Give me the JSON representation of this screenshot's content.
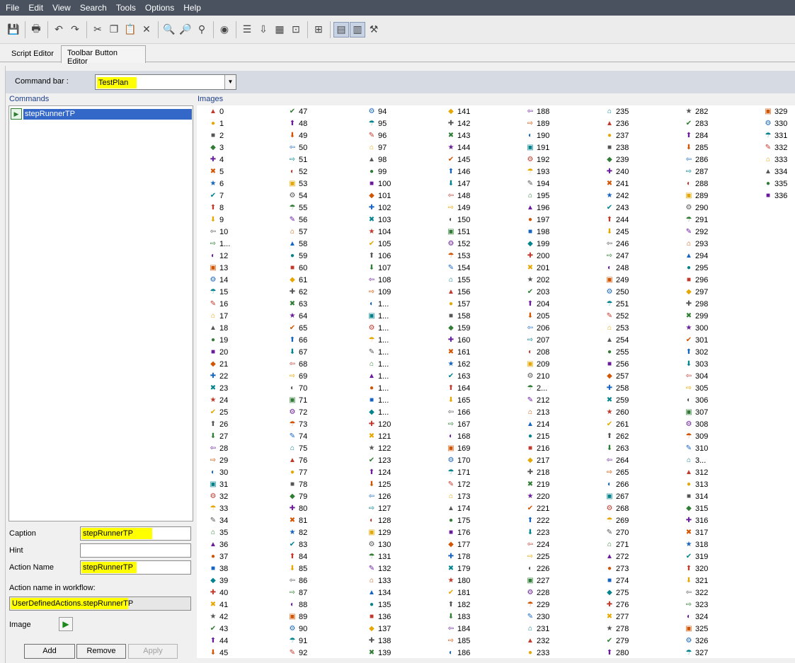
{
  "menu": [
    "File",
    "Edit",
    "View",
    "Search",
    "Tools",
    "Options",
    "Help"
  ],
  "toolbar_icons": [
    "save-icon",
    "print-icon",
    "undo-icon",
    "redo-icon",
    "cut-icon",
    "copy-icon",
    "paste-icon",
    "delete-icon",
    "find-icon",
    "find-next-icon",
    "replace-icon",
    "globe-icon",
    "list-icon",
    "step-icon",
    "grid-icon",
    "export-icon",
    "filter-icon",
    "view-left-icon",
    "view-right-icon",
    "tools-icon"
  ],
  "tabs": [
    "Script Editor",
    "Toolbar Button Editor"
  ],
  "command_bar": {
    "label": "Command bar :",
    "value": "TestPlan"
  },
  "commands": {
    "header": "Commands",
    "items": [
      "stepRunnerTP"
    ]
  },
  "images": {
    "header": "Images",
    "columns": [
      [
        "0",
        "1",
        "2",
        "3",
        "4",
        "5",
        "6",
        "7",
        "8",
        "9",
        "10",
        "1...",
        "12",
        "13",
        "14",
        "15",
        "16",
        "17",
        "18",
        "19",
        "20",
        "21",
        "22",
        "23",
        "24",
        "25",
        "26",
        "27",
        "28",
        "29",
        "30",
        "31",
        "32",
        "33",
        "34",
        "35",
        "36",
        "37",
        "38",
        "39",
        "40",
        "41",
        "42",
        "43",
        "44",
        "45"
      ],
      [
        "47",
        "48",
        "49",
        "50",
        "51",
        "52",
        "53",
        "54",
        "55",
        "56",
        "57",
        "58",
        "59",
        "60",
        "61",
        "62",
        "63",
        "64",
        "65",
        "66",
        "67",
        "68",
        "69",
        "70",
        "71",
        "72",
        "73",
        "74",
        "75",
        "76",
        "77",
        "78",
        "79",
        "80",
        "81",
        "82",
        "83",
        "84",
        "85",
        "86",
        "87",
        "88",
        "89",
        "90",
        "91",
        "92"
      ],
      [
        "94",
        "95",
        "96",
        "97",
        "98",
        "99",
        "100",
        "101",
        "102",
        "103",
        "104",
        "105",
        "106",
        "107",
        "108",
        "109",
        "1...",
        "1...",
        "1...",
        "1...",
        "1...",
        "1...",
        "1...",
        "1...",
        "1...",
        "1...",
        "120",
        "121",
        "122",
        "123",
        "124",
        "125",
        "126",
        "127",
        "128",
        "129",
        "130",
        "131",
        "132",
        "133",
        "134",
        "135",
        "136",
        "137",
        "138",
        "139"
      ],
      [
        "141",
        "142",
        "143",
        "144",
        "145",
        "146",
        "147",
        "148",
        "149",
        "150",
        "151",
        "152",
        "153",
        "154",
        "155",
        "156",
        "157",
        "158",
        "159",
        "160",
        "161",
        "162",
        "163",
        "164",
        "165",
        "166",
        "167",
        "168",
        "169",
        "170",
        "171",
        "172",
        "173",
        "174",
        "175",
        "176",
        "177",
        "178",
        "179",
        "180",
        "181",
        "182",
        "183",
        "184",
        "185",
        "186"
      ],
      [
        "188",
        "189",
        "190",
        "191",
        "192",
        "193",
        "194",
        "195",
        "196",
        "197",
        "198",
        "199",
        "200",
        "201",
        "202",
        "203",
        "204",
        "205",
        "206",
        "207",
        "208",
        "209",
        "210",
        "2...",
        "212",
        "213",
        "214",
        "215",
        "216",
        "217",
        "218",
        "219",
        "220",
        "221",
        "222",
        "223",
        "224",
        "225",
        "226",
        "227",
        "228",
        "229",
        "230",
        "231",
        "232",
        "233"
      ],
      [
        "235",
        "236",
        "237",
        "238",
        "239",
        "240",
        "241",
        "242",
        "243",
        "244",
        "245",
        "246",
        "247",
        "248",
        "249",
        "250",
        "251",
        "252",
        "253",
        "254",
        "255",
        "256",
        "257",
        "258",
        "259",
        "260",
        "261",
        "262",
        "263",
        "264",
        "265",
        "266",
        "267",
        "268",
        "269",
        "270",
        "271",
        "272",
        "273",
        "274",
        "275",
        "276",
        "277",
        "278",
        "279",
        "280"
      ],
      [
        "282",
        "283",
        "284",
        "285",
        "286",
        "287",
        "288",
        "289",
        "290",
        "291",
        "292",
        "293",
        "294",
        "295",
        "296",
        "297",
        "298",
        "299",
        "300",
        "301",
        "302",
        "303",
        "304",
        "305",
        "306",
        "307",
        "308",
        "309",
        "310",
        "3...",
        "312",
        "313",
        "314",
        "315",
        "316",
        "317",
        "318",
        "319",
        "320",
        "321",
        "322",
        "323",
        "324",
        "325",
        "326",
        "327"
      ],
      [
        "329",
        "330",
        "331",
        "332",
        "333",
        "334",
        "335",
        "336"
      ]
    ]
  },
  "form": {
    "caption_label": "Caption",
    "caption_value": "stepRunnerTP",
    "hint_label": "Hint",
    "hint_value": "",
    "action_label": "Action Name",
    "action_value": "stepRunnerTP",
    "workflow_label": "Action name in workflow:",
    "workflow_value": "UserDefinedActions.stepRunnerTP",
    "image_label": "Image"
  },
  "buttons": {
    "add": "Add",
    "remove": "Remove",
    "apply": "Apply"
  }
}
